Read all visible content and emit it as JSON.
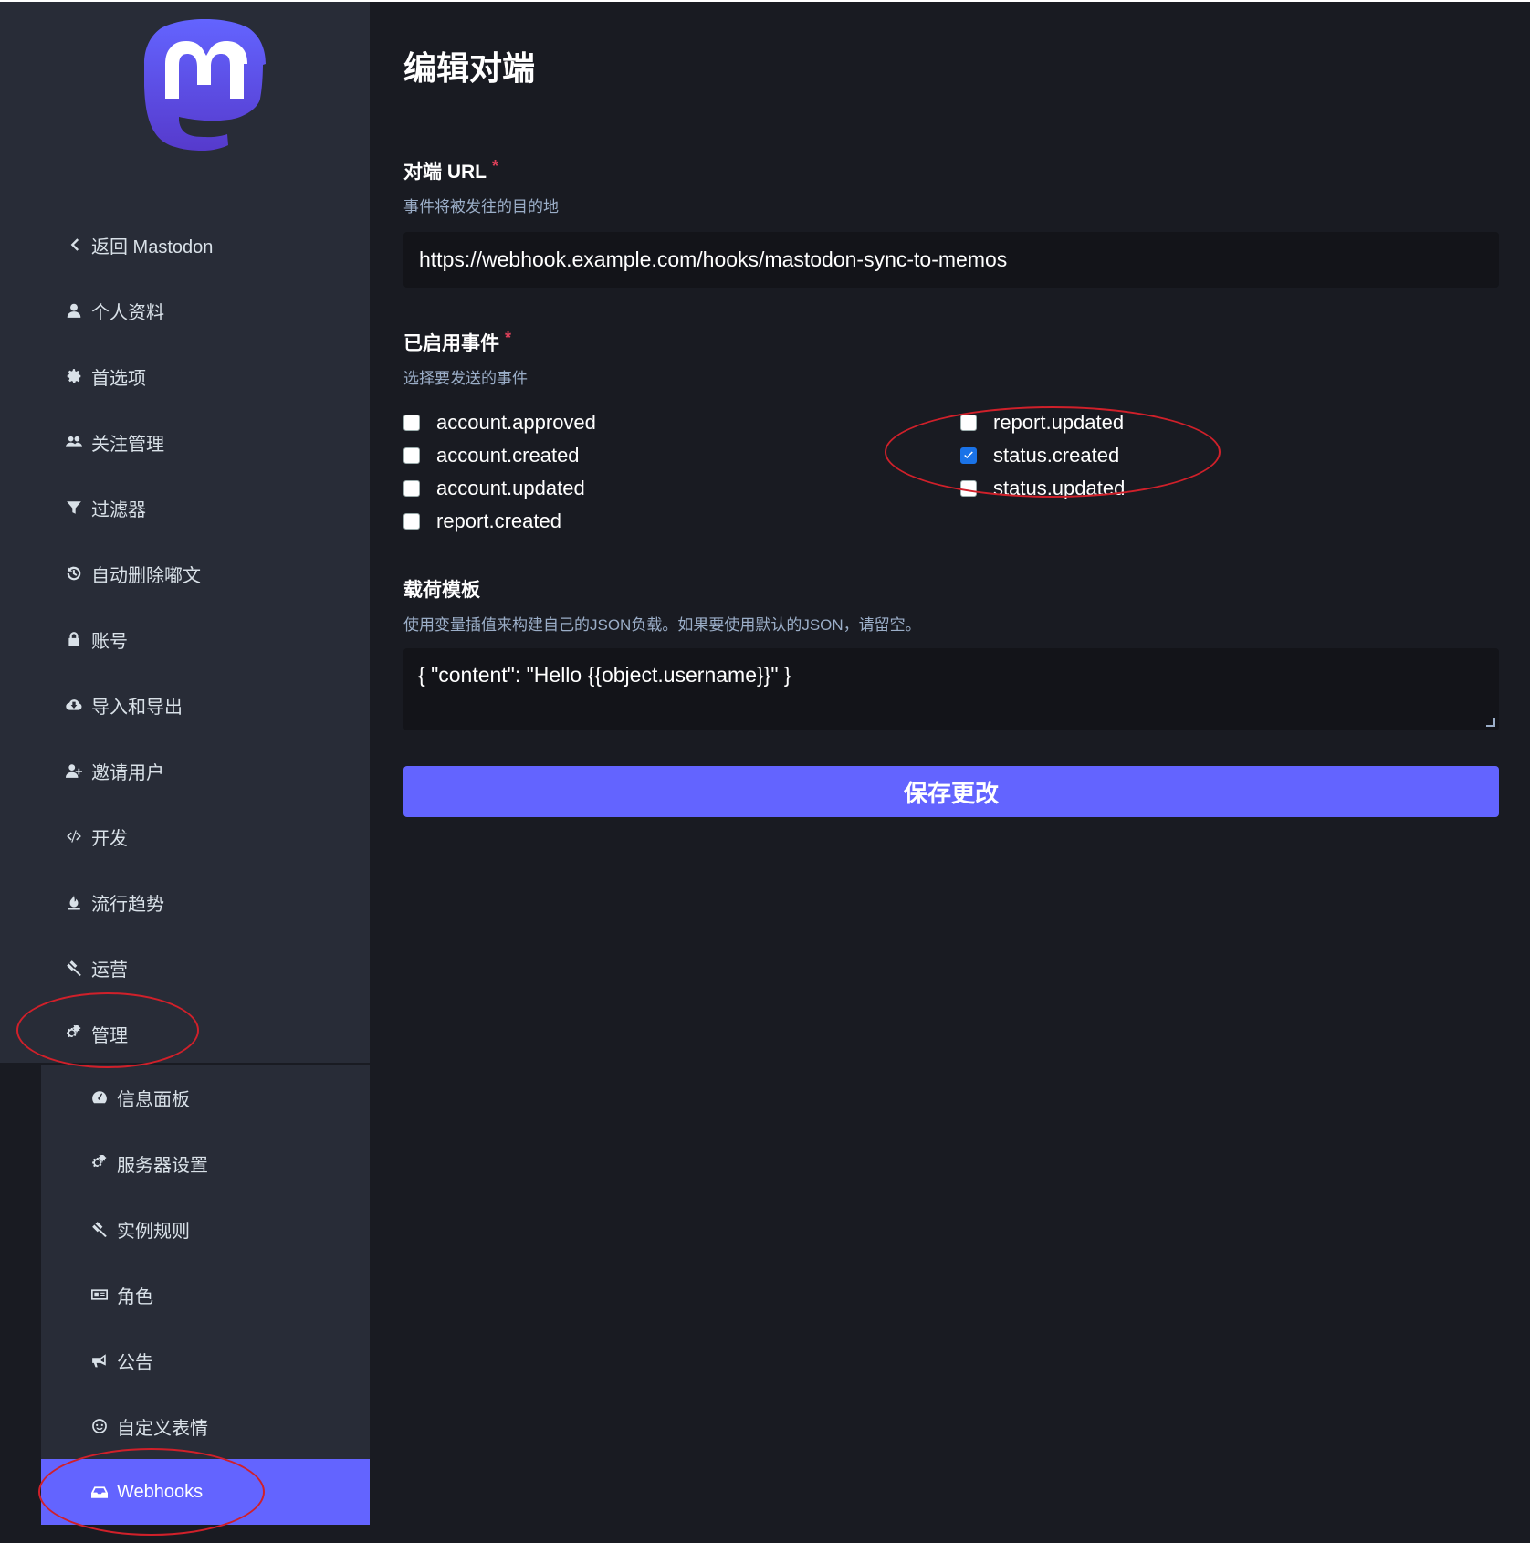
{
  "page_title": "编辑对端",
  "sidebar": {
    "items": [
      {
        "label": "返回 Mastodon",
        "icon": "chevron-left-icon"
      },
      {
        "label": "个人资料",
        "icon": "user-icon"
      },
      {
        "label": "首选项",
        "icon": "gear-icon"
      },
      {
        "label": "关注管理",
        "icon": "users-icon"
      },
      {
        "label": "过滤器",
        "icon": "filter-icon"
      },
      {
        "label": "自动删除嘟文",
        "icon": "history-icon"
      },
      {
        "label": "账号",
        "icon": "lock-icon"
      },
      {
        "label": "导入和导出",
        "icon": "cloud-download-icon"
      },
      {
        "label": "邀请用户",
        "icon": "user-plus-icon"
      },
      {
        "label": "开发",
        "icon": "code-icon"
      },
      {
        "label": "流行趋势",
        "icon": "fire-icon"
      },
      {
        "label": "运营",
        "icon": "gavel-icon"
      },
      {
        "label": "管理",
        "icon": "cogs-icon"
      }
    ],
    "sub_items": [
      {
        "label": "信息面板",
        "icon": "dashboard-icon"
      },
      {
        "label": "服务器设置",
        "icon": "cogs-icon"
      },
      {
        "label": "实例规则",
        "icon": "gavel-icon"
      },
      {
        "label": "角色",
        "icon": "id-card-icon"
      },
      {
        "label": "公告",
        "icon": "bullhorn-icon"
      },
      {
        "label": "自定义表情",
        "icon": "smile-icon"
      },
      {
        "label": "Webhooks",
        "icon": "inbox-icon",
        "active": true
      }
    ]
  },
  "url_field": {
    "label": "对端 URL",
    "required_mark": "*",
    "hint": "事件将被发往的目的地",
    "value": "https://webhook.example.com/hooks/mastodon-sync-to-memos"
  },
  "events_field": {
    "label": "已启用事件",
    "required_mark": "*",
    "hint": "选择要发送的事件",
    "options": [
      {
        "label": "account.approved",
        "checked": false
      },
      {
        "label": "account.created",
        "checked": false
      },
      {
        "label": "account.updated",
        "checked": false
      },
      {
        "label": "report.created",
        "checked": false
      },
      {
        "label": "report.updated",
        "checked": false
      },
      {
        "label": "status.created",
        "checked": true
      },
      {
        "label": "status.updated",
        "checked": false
      }
    ]
  },
  "template_field": {
    "label": "载荷模板",
    "hint": "使用变量插值来构建自己的JSON负载。如果要使用默认的JSON，请留空。",
    "value": "{ \"content\": \"Hello {{object.username}}\" }"
  },
  "save_button": "保存更改",
  "colors": {
    "accent": "#6364ff",
    "sidebar_bg": "#282c37",
    "page_bg": "#191b22",
    "required": "#df405a",
    "annotation": "#d0202a"
  }
}
